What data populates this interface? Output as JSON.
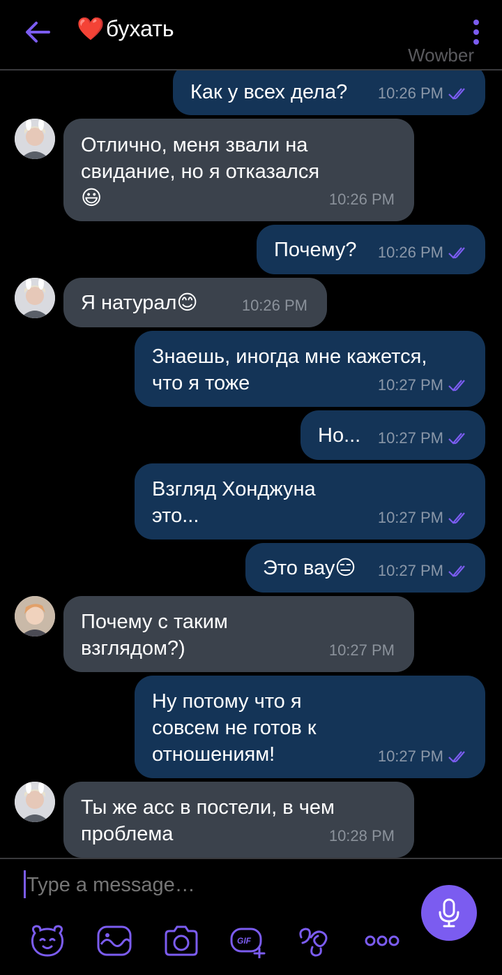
{
  "header": {
    "title_emoji": "❤️",
    "title": "бухать",
    "watermark": "Wowber"
  },
  "messages": [
    {
      "dir": "out",
      "text": "Как у всех дела?",
      "time": "10:26 PM"
    },
    {
      "dir": "in",
      "text": "Отлично, меня звали на\nсвидание, но я отказался\n😃",
      "time": "10:26 PM"
    },
    {
      "dir": "out",
      "text": "Почему?",
      "time": "10:26 PM"
    },
    {
      "dir": "in",
      "text": "Я натурал😊",
      "time": "10:26 PM"
    },
    {
      "dir": "out",
      "text": "Знаешь, иногда мне кажется,\nчто я тоже",
      "time": "10:27 PM"
    },
    {
      "dir": "out",
      "text": "Но...",
      "time": "10:27 PM"
    },
    {
      "dir": "out",
      "text": "Взгляд Хонджуна\nэто...",
      "time": "10:27 PM"
    },
    {
      "dir": "out",
      "text": "Это вау😑",
      "time": "10:27 PM"
    },
    {
      "dir": "in",
      "text": "Почему с таким\nвзглядом?)",
      "time": "10:27 PM"
    },
    {
      "dir": "out",
      "text": "Ну потому что я\nсовсем не готов к\nотношениям!",
      "time": "10:27 PM"
    },
    {
      "dir": "in",
      "text": "Ты же асс в постели, в чем\nпроблема",
      "time": "10:28 PM"
    }
  ],
  "composer": {
    "placeholder": "Type a message…",
    "tools": [
      "sticker-icon",
      "doodle-icon",
      "camera-icon",
      "gif-icon",
      "trivia-icon",
      "more-icon"
    ]
  },
  "colors": {
    "accent": "#7b5cf0",
    "outgoing_bubble": "#143457",
    "incoming_bubble": "#3b424c",
    "background": "#000000"
  }
}
